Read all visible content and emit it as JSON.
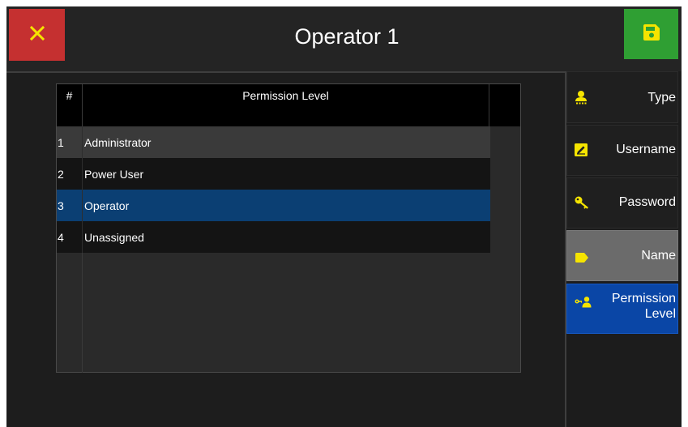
{
  "window": {
    "title": "Operator 1"
  },
  "header": {
    "close_icon": "close-icon",
    "save_icon": "save-icon",
    "colors": {
      "close": "#c53030",
      "save": "#2f9f33",
      "icon_accent": "#f5e400"
    }
  },
  "table": {
    "headers": {
      "num": "#",
      "level": "Permission Level"
    },
    "rows": [
      {
        "num": "1",
        "level": "Administrator"
      },
      {
        "num": "2",
        "level": "Power User"
      },
      {
        "num": "3",
        "level": "Operator",
        "selected": true
      },
      {
        "num": "4",
        "level": "Unassigned"
      }
    ],
    "colors": {
      "selected": "#0b3f73"
    }
  },
  "sidebar": {
    "items": [
      {
        "label": "Type",
        "icon": "user-icon"
      },
      {
        "label": "Username",
        "icon": "edit-icon"
      },
      {
        "label": "Password",
        "icon": "key-icon"
      },
      {
        "label": "Name",
        "icon": "tag-icon"
      },
      {
        "label_line1": "Permission",
        "label_line2": "Level",
        "icon": "user-key-icon",
        "active": true
      }
    ],
    "colors": {
      "active": "#0a46a6",
      "hover": "#6b6b6b"
    }
  }
}
